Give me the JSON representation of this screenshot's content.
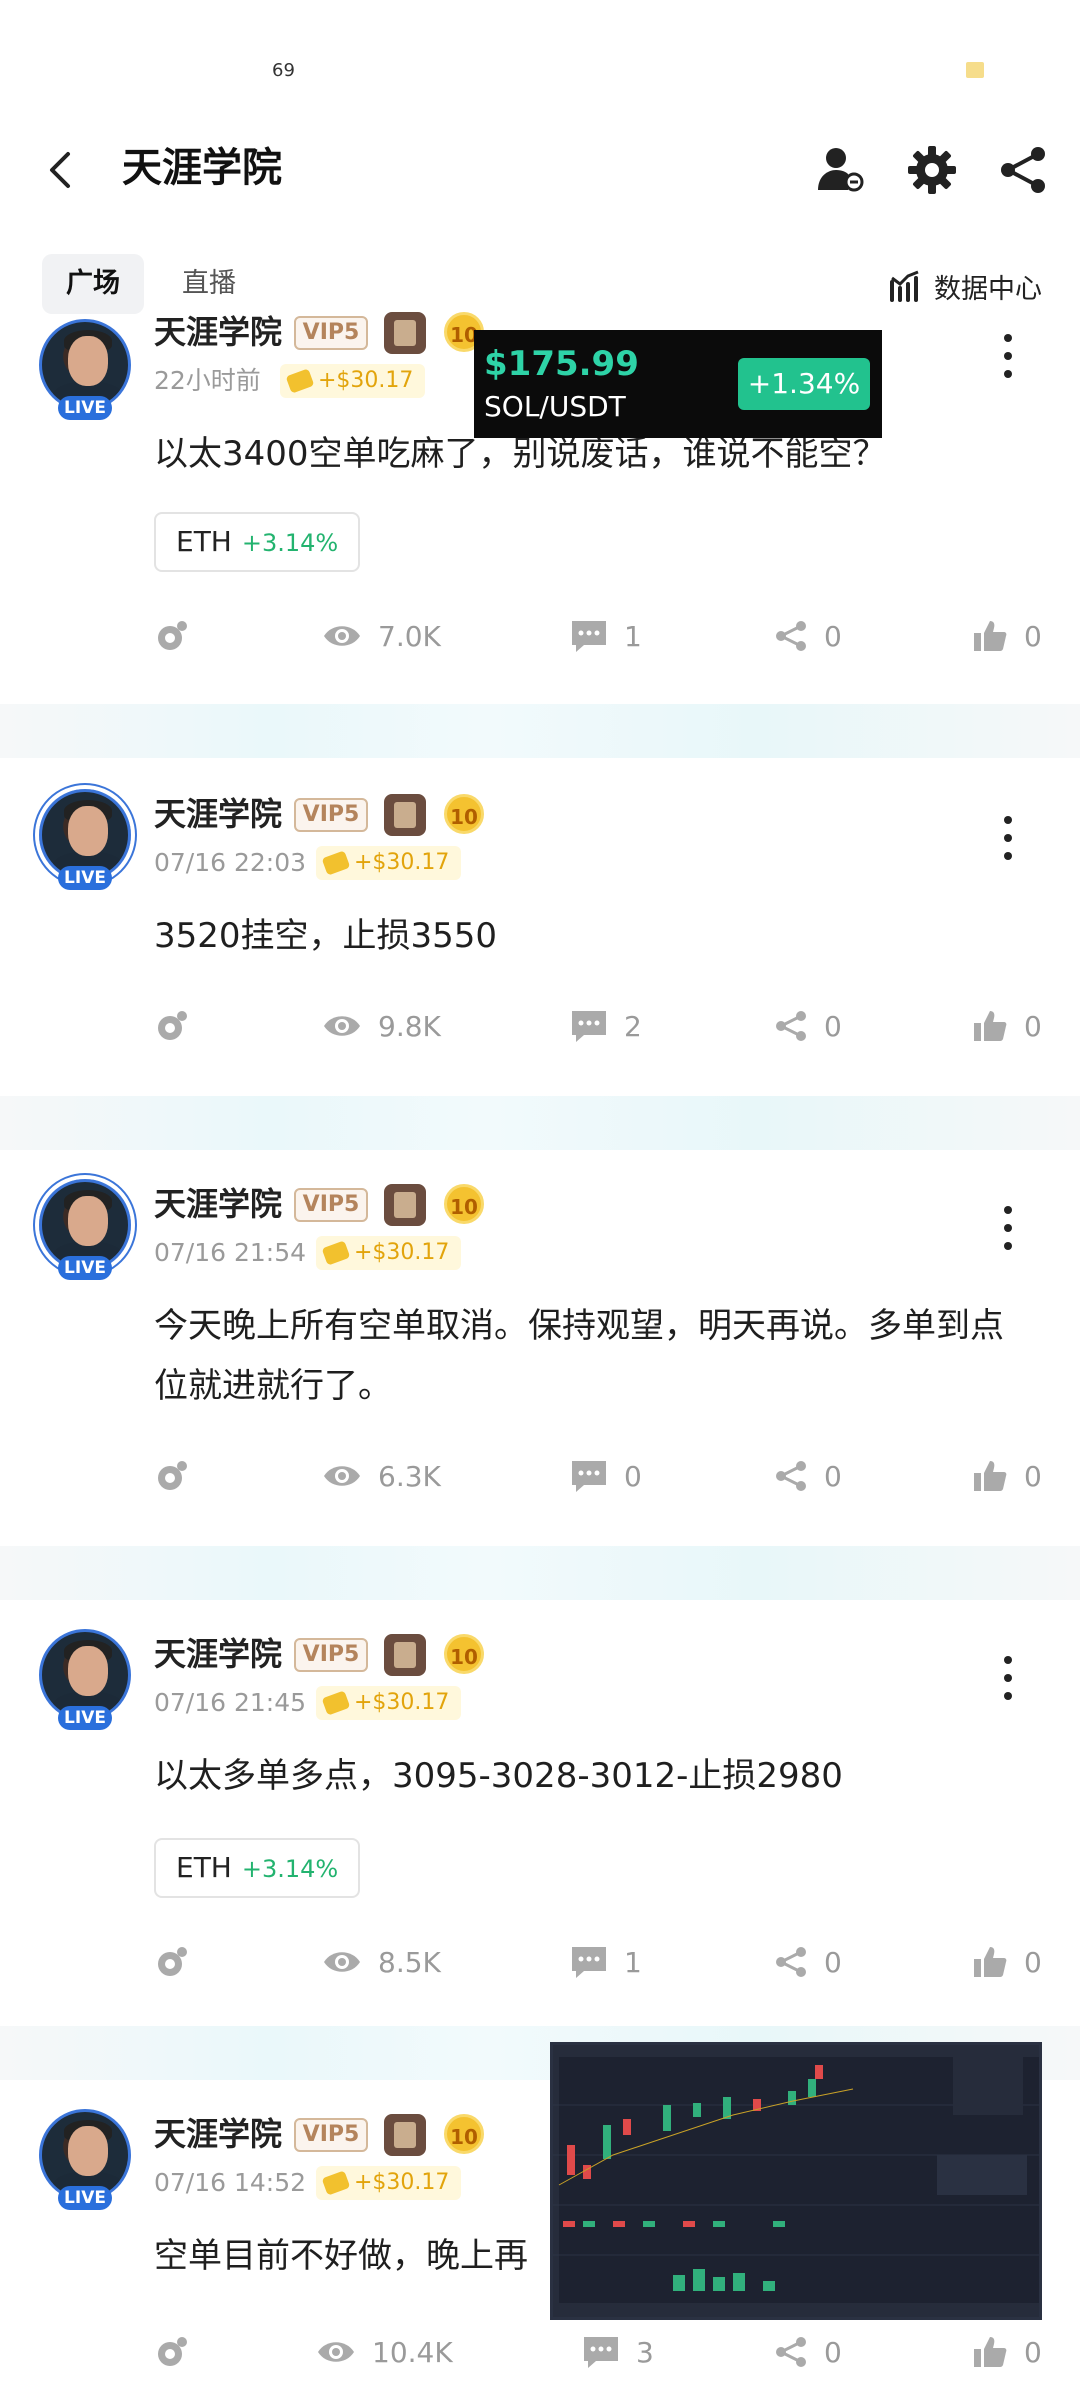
{
  "status_bar": {
    "left_text": "69"
  },
  "header": {
    "title": "天涯学院"
  },
  "tabs": [
    {
      "label": "广场",
      "active": true
    },
    {
      "label": "直播",
      "active": false
    }
  ],
  "data_center": {
    "label": "数据中心"
  },
  "ticker": {
    "price": "$175.99",
    "pair": "SOL/USDT",
    "change": "+1.34%"
  },
  "posts": [
    {
      "author": "天涯学院",
      "vip": "VIP5",
      "level": "10",
      "live": "LIVE",
      "time": "22小时前",
      "reward": "+$30.17",
      "content": "以太3400空单吃麻了，别说废话，谁说不能空？",
      "tag": {
        "symbol": "ETH",
        "change": "+3.14%"
      },
      "views": "7.0K",
      "comments": "1",
      "shares": "0",
      "likes": "0"
    },
    {
      "author": "天涯学院",
      "vip": "VIP5",
      "level": "10",
      "live": "LIVE",
      "time": "07/16 22:03",
      "reward": "+$30.17",
      "content": "3520挂空，止损3550",
      "views": "9.8K",
      "comments": "2",
      "shares": "0",
      "likes": "0"
    },
    {
      "author": "天涯学院",
      "vip": "VIP5",
      "level": "10",
      "live": "LIVE",
      "time": "07/16 21:54",
      "reward": "+$30.17",
      "content": "今天晚上所有空单取消。保持观望，明天再说。多单到点位就进就行了。",
      "views": "6.3K",
      "comments": "0",
      "shares": "0",
      "likes": "0"
    },
    {
      "author": "天涯学院",
      "vip": "VIP5",
      "level": "10",
      "live": "LIVE",
      "time": "07/16 21:45",
      "reward": "+$30.17",
      "content": "以太多单多点，3095-3028-3012-止损2980",
      "tag": {
        "symbol": "ETH",
        "change": "+3.14%"
      },
      "views": "8.5K",
      "comments": "1",
      "shares": "0",
      "likes": "0"
    },
    {
      "author": "天涯学院",
      "vip": "VIP5",
      "level": "10",
      "live": "LIVE",
      "time": "07/16 14:52",
      "reward": "+$30.17",
      "content": "空单目前不好做，晚上再",
      "views": "10.4K",
      "comments": "3",
      "shares": "0",
      "likes": "0"
    }
  ]
}
